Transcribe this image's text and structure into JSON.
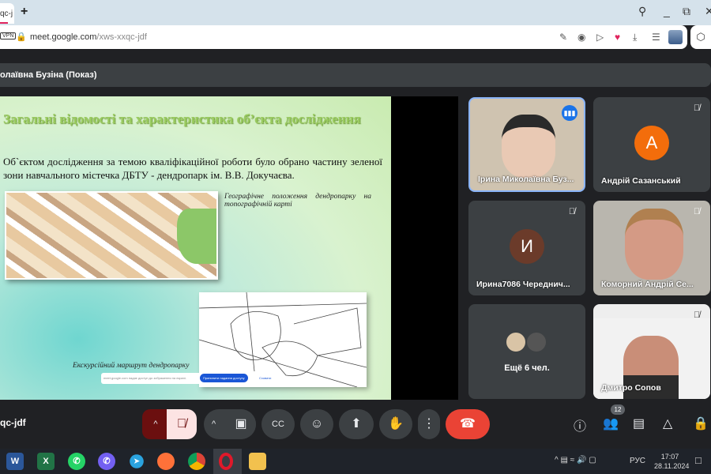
{
  "browser": {
    "tab_label": "qc-j",
    "url_host": "meet.google.com",
    "url_path": "/xws-xxqc-jdf",
    "vpn": "VPN"
  },
  "meet": {
    "presenter_title": "олаївна Бузіна (Показ)",
    "meeting_code": "qc-jdf",
    "participants_count": "12"
  },
  "slide": {
    "title": "Загальні відомості та характеристика об’єкта дослідження",
    "body": "Об`єктом дослідження за темою кваліфікаційної роботи було обрано частину зеленої зони навчального містечка ДБТУ -  дендропарк ім. В.В. Докучаєва.",
    "caption1": "Географічне положення дендропарку на топографічній карті",
    "caption2": "Екскурсійний маршрут дендропарку",
    "notice_text": "meet.google.com надає доступ до зображення на екрані.",
    "notice_button": "Припинити надання доступу",
    "notice_link": "Сховати"
  },
  "participants": [
    {
      "name": "Ірина Миколаївна Буз...",
      "speaking": true
    },
    {
      "name": "Андрій Сазанський",
      "initial": "А",
      "color": "#f36d0b"
    },
    {
      "name": "Ирина7086 Череднич...",
      "initial": "И",
      "color": "#6b3b2a"
    },
    {
      "name": "Коморний Андрій Се..."
    },
    {
      "label": "Ещё 6 чел."
    },
    {
      "name": "Дмитро Сопов"
    }
  ],
  "taskbar": {
    "lang": "РУС",
    "time": "17:07",
    "date": "28.11.2024"
  },
  "colors": {
    "end_call": "#ea4335",
    "mic_off": "#6b0f0f",
    "speaking": "#8ab4f8"
  }
}
